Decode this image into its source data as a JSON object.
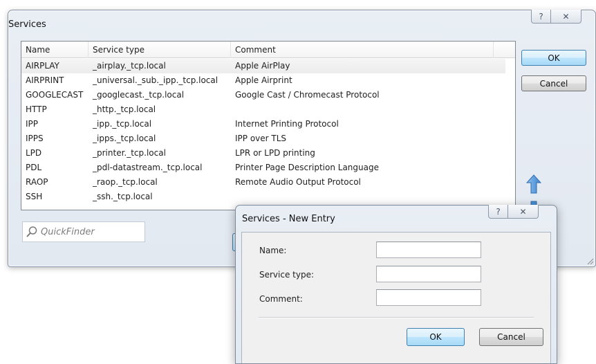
{
  "main_window": {
    "title": "Services",
    "help_glyph": "?",
    "close_glyph": "✕",
    "columns": [
      "Name",
      "Service type",
      "Comment"
    ],
    "rows": [
      {
        "name": "AIRPLAY",
        "type": "_airplay._tcp.local",
        "comment": "Apple AirPlay"
      },
      {
        "name": "AIRPRINT",
        "type": "_universal._sub._ipp._tcp.local",
        "comment": "Apple Airprint"
      },
      {
        "name": "GOOGLECAST",
        "type": "_googlecast._tcp.local",
        "comment": "Google Cast / Chromecast Protocol"
      },
      {
        "name": "HTTP",
        "type": "_http._tcp.local",
        "comment": ""
      },
      {
        "name": "IPP",
        "type": "_ipp._tcp.local",
        "comment": "Internet Printing Protocol"
      },
      {
        "name": "IPPS",
        "type": "_ipps._tcp.local",
        "comment": "IPP over TLS"
      },
      {
        "name": "LPD",
        "type": "_printer._tcp.local",
        "comment": "LPR or LPD printing"
      },
      {
        "name": "PDL",
        "type": "_pdl-datastream._tcp.local",
        "comment": "Printer Page Description Language"
      },
      {
        "name": "RAOP",
        "type": "_raop._tcp.local",
        "comment": "Remote Audio Output Protocol"
      },
      {
        "name": "SSH",
        "type": "_ssh._tcp.local",
        "comment": ""
      }
    ],
    "selected_row": 0,
    "quickfinder_placeholder": "QuickFinder",
    "ok_label": "OK",
    "cancel_label": "Cancel"
  },
  "dialog": {
    "title": "Services - New Entry",
    "help_glyph": "?",
    "close_glyph": "✕",
    "name_label": "Name:",
    "type_label": "Service type:",
    "comment_label": "Comment:",
    "name_value": "",
    "type_value": "",
    "comment_value": "",
    "ok_label": "OK",
    "cancel_label": "Cancel"
  },
  "icons": {
    "move_up": "up-arrow-icon",
    "quickfinder": "magnifier-icon",
    "resize": "resize-grip-icon"
  },
  "colors": {
    "accent_blue": "#3c7fb1",
    "arrow_blue": "#4a8fd4"
  }
}
